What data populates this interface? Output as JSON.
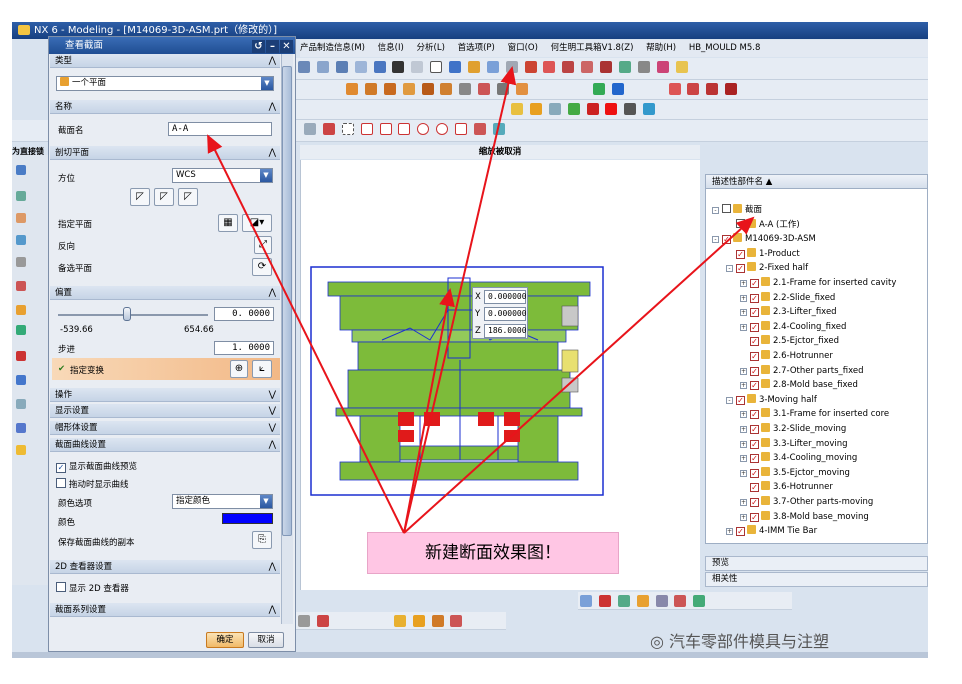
{
  "window": {
    "title": "NX 6 - Modeling - [M14069-3D-ASM.prt（修改的）]"
  },
  "menubar": {
    "items": [
      "产品制造信息(M)",
      "信息(I)",
      "分析(L)",
      "首选项(P)",
      "窗口(O)",
      "何生明工具箱V1.8(Z)",
      "帮助(H)",
      "HB_MOULD M5.8"
    ]
  },
  "left_label": "为直接锁",
  "view_title": "缩放被取消",
  "dialog": {
    "title": "查看截面",
    "type_section": "类型",
    "type_value": "一个平面",
    "name_section": "名称",
    "section_name_label": "截面名",
    "section_name_value": "A-A",
    "cut_plane_section": "剖切平面",
    "orientation_label": "方位",
    "orientation_value": "WCS",
    "specify_plane_label": "指定平面",
    "reverse_label": "反向",
    "alt_plane_label": "备选平面",
    "offset_section": "偏置",
    "offset_value": "0. 0000",
    "offset_min": "-539.66",
    "offset_max": "654.66",
    "step_label": "步进",
    "step_value": "1. 0000",
    "specify_transform_label": "指定变换",
    "operations_section": "操作",
    "display_settings_section": "显示设置",
    "cap_settings_section": "帽形体设置",
    "section_curve_section": "截面曲线设置",
    "show_curve_preview": "显示截面曲线预览",
    "show_curve_drag": "拖动时显示曲线",
    "color_option_label": "颜色选项",
    "color_option_value": "指定颜色",
    "color_label": "颜色",
    "color_value": "#0000ff",
    "save_copy_label": "保存截面曲线的副本",
    "viewer_2d_section": "2D 查看器设置",
    "show_2d_viewer": "显示 2D 查看器",
    "series_section": "截面系列设置",
    "ok_label": "确定",
    "cancel_label": "取消"
  },
  "coords": {
    "x": "0.000000",
    "y": "0.000000",
    "z": "186.0000"
  },
  "navigator": {
    "header": "描述性部件名",
    "rows": [
      {
        "pm": "-",
        "chk": false,
        "label": "截面",
        "indent": 0
      },
      {
        "pm": "",
        "chk": false,
        "label": "A-A (工作)",
        "indent": 1
      },
      {
        "pm": "-",
        "chk": true,
        "label": "M14069-3D-ASM",
        "indent": 0
      },
      {
        "pm": "",
        "chk": true,
        "label": "1-Product",
        "indent": 1
      },
      {
        "pm": "-",
        "chk": true,
        "label": "2-Fixed half",
        "indent": 1
      },
      {
        "pm": "+",
        "chk": true,
        "label": "2.1-Frame for inserted cavity",
        "indent": 2
      },
      {
        "pm": "+",
        "chk": true,
        "label": "2.2-Slide_fixed",
        "indent": 2
      },
      {
        "pm": "+",
        "chk": true,
        "label": "2.3-Lifter_fixed",
        "indent": 2
      },
      {
        "pm": "+",
        "chk": true,
        "label": "2.4-Cooling_fixed",
        "indent": 2
      },
      {
        "pm": "",
        "chk": true,
        "label": "2.5-Ejctor_fixed",
        "indent": 2
      },
      {
        "pm": "",
        "chk": true,
        "label": "2.6-Hotrunner",
        "indent": 2
      },
      {
        "pm": "+",
        "chk": true,
        "label": "2.7-Other parts_fixed",
        "indent": 2
      },
      {
        "pm": "+",
        "chk": true,
        "label": "2.8-Mold base_fixed",
        "indent": 2
      },
      {
        "pm": "-",
        "chk": true,
        "label": "3-Moving half",
        "indent": 1
      },
      {
        "pm": "+",
        "chk": true,
        "label": "3.1-Frame for inserted core",
        "indent": 2
      },
      {
        "pm": "+",
        "chk": true,
        "label": "3.2-Slide_moving",
        "indent": 2
      },
      {
        "pm": "+",
        "chk": true,
        "label": "3.3-Lifter_moving",
        "indent": 2
      },
      {
        "pm": "+",
        "chk": true,
        "label": "3.4-Cooling_moving",
        "indent": 2
      },
      {
        "pm": "+",
        "chk": true,
        "label": "3.5-Ejctor_moving",
        "indent": 2
      },
      {
        "pm": "",
        "chk": true,
        "label": "3.6-Hotrunner",
        "indent": 2
      },
      {
        "pm": "+",
        "chk": true,
        "label": "3.7-Other parts-moving",
        "indent": 2
      },
      {
        "pm": "+",
        "chk": true,
        "label": "3.8-Mold base_moving",
        "indent": 2
      },
      {
        "pm": "+",
        "chk": true,
        "label": "4-IMM Tie Bar",
        "indent": 1
      }
    ]
  },
  "panel_preview": "预览",
  "panel_related": "相关性",
  "callout_text": "新建断面效果图！",
  "watermark_text": "汽车零部件模具与注塑",
  "colors": {
    "arrow": "#e8141b",
    "mold_green": "#7dbb3a",
    "mold_blue": "#1b2fd0"
  }
}
